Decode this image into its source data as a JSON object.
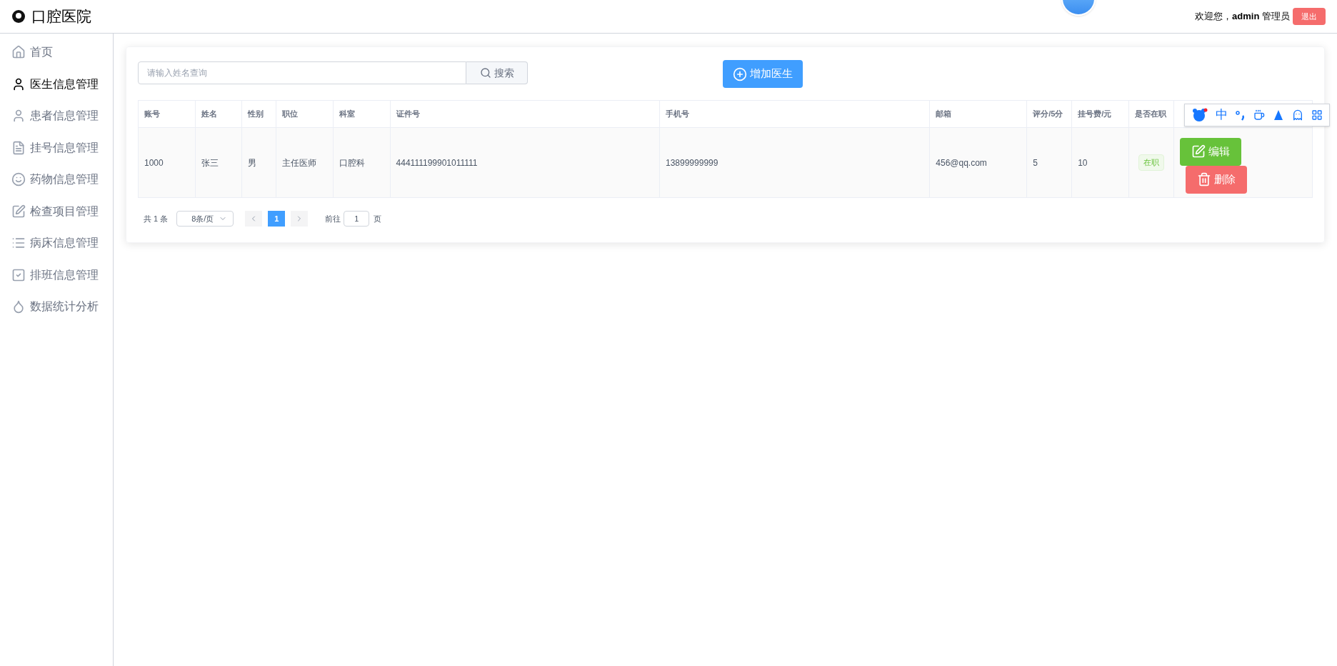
{
  "header": {
    "logo": "口腔医院",
    "welcome": "欢迎您，",
    "username": "admin",
    "role": "管理员",
    "logout": "退出"
  },
  "sidebar": {
    "items": [
      {
        "label": "首页",
        "kind": "home",
        "selected": false
      },
      {
        "label": "医生信息管理",
        "kind": "doctor",
        "selected": true
      },
      {
        "label": "患者信息管理",
        "kind": "user",
        "selected": false
      },
      {
        "label": "挂号信息管理",
        "kind": "doc",
        "selected": false
      },
      {
        "label": "药物信息管理",
        "kind": "face",
        "selected": false
      },
      {
        "label": "检查项目管理",
        "kind": "edit",
        "selected": false
      },
      {
        "label": "病床信息管理",
        "kind": "list",
        "selected": false
      },
      {
        "label": "排班信息管理",
        "kind": "check",
        "selected": false
      },
      {
        "label": "数据统计分析",
        "kind": "drop",
        "selected": false
      }
    ]
  },
  "search": {
    "placeholder": "请输入姓名查询",
    "button": "搜索"
  },
  "add_button": "增加医生",
  "table": {
    "columns": [
      "账号",
      "姓名",
      "性别",
      "职位",
      "科室",
      "证件号",
      "手机号",
      "邮箱",
      "评分/5分",
      "挂号费/元",
      "是否在职"
    ],
    "rows": [
      {
        "cells": [
          "1000",
          "张三",
          "男",
          "主任医师",
          "口腔科",
          "444111199901011111",
          "13899999999",
          "456@qq.com",
          "5",
          "10"
        ],
        "status": "在职",
        "active": true,
        "edit": "编辑",
        "delete": "删除"
      }
    ]
  },
  "pagination": {
    "total": "共 1 条",
    "page_size": "8条/页",
    "pages": [
      {
        "label": "1",
        "selected": true
      }
    ],
    "goto_label": "前往",
    "goto_value": "1",
    "goto_suffix": "页"
  },
  "ime_toolbar": {
    "lang": "中"
  }
}
